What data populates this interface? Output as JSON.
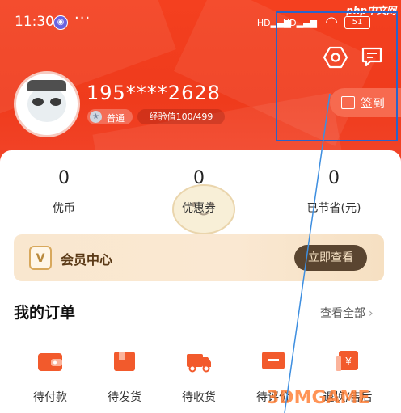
{
  "status_bar": {
    "time": "11:30",
    "more": "···",
    "signal_a": "HD",
    "signal_b": "HD",
    "battery": "51"
  },
  "watermark_top": "php中文网",
  "profile": {
    "phone": "195****2628",
    "level_label": "普通",
    "exp_label": "经验值100/499"
  },
  "header_actions": {
    "settings_icon": "hexagon-settings-icon",
    "message_icon": "message-icon",
    "signin_label": "签到"
  },
  "stats": [
    {
      "value": "0",
      "label": "优币"
    },
    {
      "value": "0",
      "label": "优惠券"
    },
    {
      "value": "0",
      "label": "已节省(元)"
    }
  ],
  "vip": {
    "badge": "V",
    "title": "会员中心",
    "button": "立即查看"
  },
  "orders": {
    "title": "我的订单",
    "view_all": "查看全部",
    "items": [
      {
        "label": "待付款",
        "icon": "wallet-icon"
      },
      {
        "label": "待发货",
        "icon": "package-icon"
      },
      {
        "label": "待收货",
        "icon": "truck-icon"
      },
      {
        "label": "待评价",
        "icon": "comment-icon"
      },
      {
        "label": "退换/售后",
        "icon": "refund-icon"
      }
    ]
  },
  "watermark_bottom": "3DMGAME",
  "colors": {
    "brand_red": "#f0401f",
    "highlight_blue": "#2b63c9",
    "order_icon": "#f25a2c",
    "vip_text": "#5b3a17"
  }
}
